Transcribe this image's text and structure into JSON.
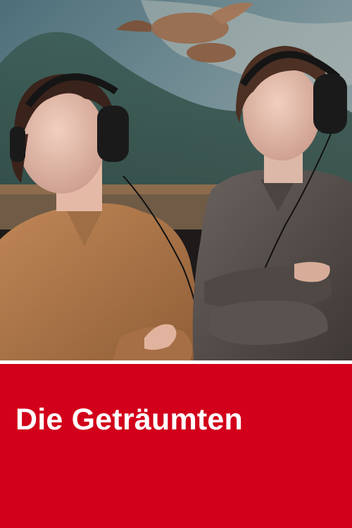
{
  "poster": {
    "title": "Die Geträumten"
  },
  "colors": {
    "panel": "#d2001a",
    "divider": "#ffffff",
    "title_text": "#ffffff",
    "woman_shirt": "#b27a4c",
    "man_shirt": "#5b5350",
    "background_mural": "#6e8790"
  }
}
